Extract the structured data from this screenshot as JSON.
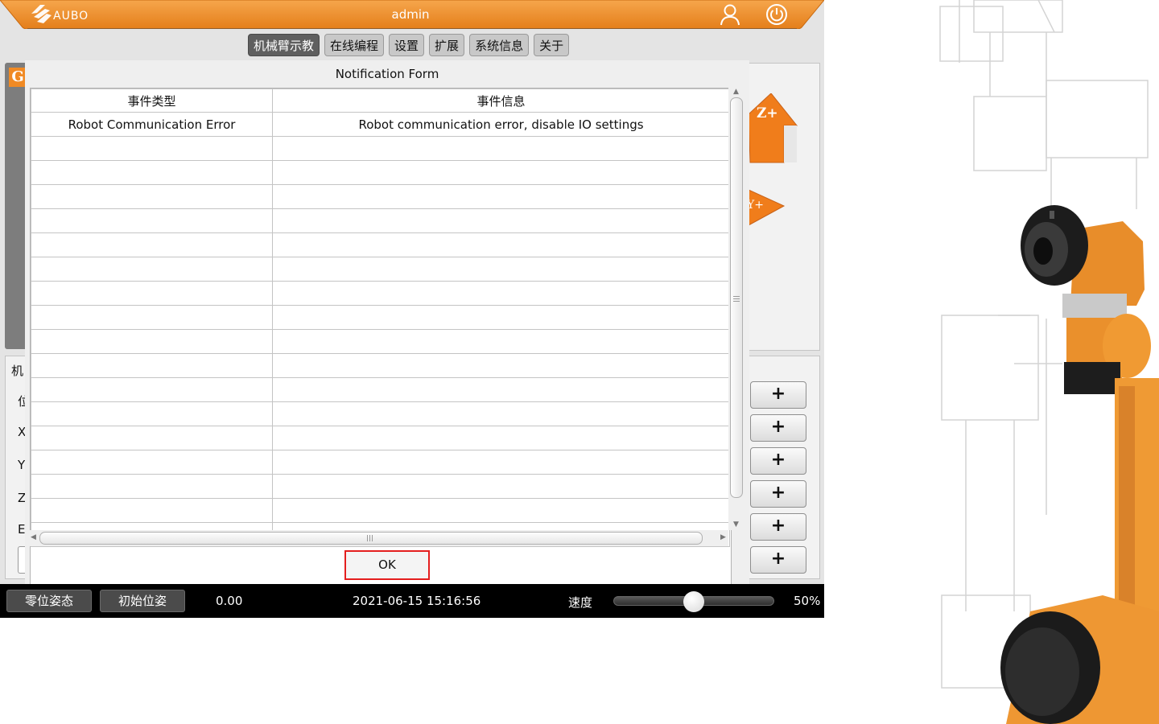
{
  "app": {
    "logo_text": "AUBO",
    "username": "admin"
  },
  "tabs": [
    {
      "label": "机械臂示教",
      "active": true
    },
    {
      "label": "在线编程",
      "active": false
    },
    {
      "label": "设置",
      "active": false
    },
    {
      "label": "扩展",
      "active": false
    },
    {
      "label": "系统信息",
      "active": false
    },
    {
      "label": "关于",
      "active": false
    }
  ],
  "background": {
    "left_badge": "G",
    "left_labels": [
      "机",
      "位",
      "X",
      "Y",
      "Z",
      "E"
    ],
    "right_buttons": [
      "+",
      "+",
      "+",
      "+",
      "+",
      "+"
    ],
    "arrow_z_label": "Z+",
    "arrow_y_label": "Y+"
  },
  "dialog": {
    "title": "Notification Form",
    "columns": [
      "事件类型",
      "事件信息"
    ],
    "rows": [
      [
        "Robot Communication Error",
        "Robot communication error, disable IO settings"
      ],
      [
        "",
        ""
      ],
      [
        "",
        ""
      ],
      [
        "",
        ""
      ],
      [
        "",
        ""
      ],
      [
        "",
        ""
      ],
      [
        "",
        ""
      ],
      [
        "",
        ""
      ],
      [
        "",
        ""
      ],
      [
        "",
        ""
      ],
      [
        "",
        ""
      ],
      [
        "",
        ""
      ],
      [
        "",
        ""
      ],
      [
        "",
        ""
      ],
      [
        "",
        ""
      ],
      [
        "",
        ""
      ],
      [
        "",
        ""
      ],
      [
        "",
        ""
      ]
    ],
    "ok_label": "OK"
  },
  "statusbar": {
    "zero_pose_label": "零位姿态",
    "init_pose_label": "初始位姿",
    "value": "0.00",
    "datetime": "2021-06-15 15:16:56",
    "speed_label": "速度",
    "speed_percent": 50,
    "speed_text": "50%"
  },
  "colors": {
    "brand_orange": "#f08a24",
    "ok_highlight": "#e41e1e"
  }
}
